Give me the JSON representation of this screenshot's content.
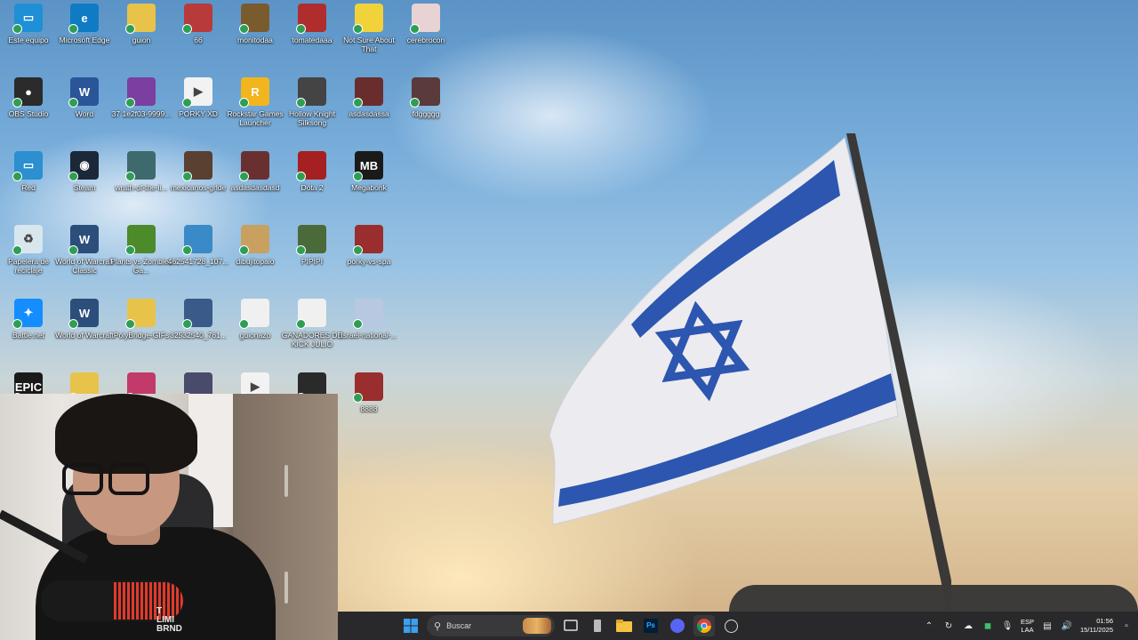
{
  "desktop_icons": [
    {
      "id": "este-equipo",
      "label": "Este equipo",
      "color": "#1f8fd6",
      "glyph": "▭"
    },
    {
      "id": "edge",
      "label": "Microsoft Edge",
      "color": "#0f7bc4",
      "glyph": "e"
    },
    {
      "id": "guion",
      "label": "guion",
      "color": "#e8c34a",
      "glyph": ""
    },
    {
      "id": "66",
      "label": "66",
      "color": "#b83a3a",
      "glyph": ""
    },
    {
      "id": "monitodaa",
      "label": "monitodaa",
      "color": "#7a5b2d",
      "glyph": ""
    },
    {
      "id": "tomatedaaa",
      "label": "tomatedaaa",
      "color": "#b02d2d",
      "glyph": ""
    },
    {
      "id": "notsure",
      "label": "Not Sure About That",
      "color": "#f2d23b",
      "glyph": ""
    },
    {
      "id": "cerebrocon",
      "label": "cerebrocon",
      "color": "#e7d3d3",
      "glyph": ""
    },
    {
      "id": "obs",
      "label": "OBS Studio",
      "color": "#2b2b2b",
      "glyph": "●"
    },
    {
      "id": "word",
      "label": "Word",
      "color": "#2a5699",
      "glyph": "W"
    },
    {
      "id": "37lea",
      "label": "37 1e2f03-9999...",
      "color": "#7a3fa0",
      "glyph": ""
    },
    {
      "id": "porky",
      "label": "PORKY XD",
      "color": "#f2f2f2",
      "glyph": "▶"
    },
    {
      "id": "rockstar",
      "label": "Rockstar Games Launcher",
      "color": "#f3b51d",
      "glyph": "R"
    },
    {
      "id": "hollow",
      "label": "Hollow Knight Silksong",
      "color": "#444",
      "glyph": ""
    },
    {
      "id": "asdasdassa",
      "label": "asdasdassa",
      "color": "#6a2d2d",
      "glyph": ""
    },
    {
      "id": "fdggggg",
      "label": "fdggggg",
      "color": "#5a3a3a",
      "glyph": ""
    },
    {
      "id": "red",
      "label": "Red",
      "color": "#2b8fd0",
      "glyph": "▭"
    },
    {
      "id": "steam",
      "label": "Steam",
      "color": "#1b2838",
      "glyph": "◉"
    },
    {
      "id": "wrath",
      "label": "wrath-of-the-li...",
      "color": "#3e6a6e",
      "glyph": ""
    },
    {
      "id": "mexicanos",
      "label": "mexicanos-grlde",
      "color": "#5a4030",
      "glyph": ""
    },
    {
      "id": "asdasdasdasd",
      "label": "asdasdasdasd",
      "color": "#6a3030",
      "glyph": ""
    },
    {
      "id": "dota2",
      "label": "Dota 2",
      "color": "#a52020",
      "glyph": ""
    },
    {
      "id": "megabonk",
      "label": "Megabonk",
      "color": "#1a1a1a",
      "glyph": "MB"
    },
    {
      "id": "papelera",
      "label": "Papelera de reciclaje",
      "color": "#d8e6ee",
      "glyph": "♻"
    },
    {
      "id": "wowclassic",
      "label": "World of Warcraft Classic",
      "color": "#2c4e7a",
      "glyph": "W"
    },
    {
      "id": "plants",
      "label": "Plants vs Zombies Ga...",
      "color": "#4c8a2a",
      "glyph": ""
    },
    {
      "id": "462",
      "label": "462541728_107...",
      "color": "#3a8ac8",
      "glyph": ""
    },
    {
      "id": "dibujito",
      "label": "dibujitopalo",
      "color": "#c8a060",
      "glyph": ""
    },
    {
      "id": "pipipi",
      "label": "PIPIPI",
      "color": "#4a6a3a",
      "glyph": ""
    },
    {
      "id": "porkyvs",
      "label": "porky-vs-spa",
      "color": "#9a2d2d",
      "glyph": ""
    },
    {
      "id": "battlenet",
      "label": "Battle.net",
      "color": "#148eff",
      "glyph": "✦"
    },
    {
      "id": "wow",
      "label": "World of Warcraft",
      "color": "#2c4e7a",
      "glyph": "W"
    },
    {
      "id": "polybridge",
      "label": "PolyBridge-GIFs",
      "color": "#e8c34a",
      "glyph": ""
    },
    {
      "id": "3253",
      "label": "32532540_761...",
      "color": "#3a5a8a",
      "glyph": ""
    },
    {
      "id": "guionazo",
      "label": "guionazo",
      "color": "#f0f0f0",
      "glyph": ""
    },
    {
      "id": "ganadores",
      "label": "GANADORES DE KICK JULIO",
      "color": "#f0f0f0",
      "glyph": ""
    },
    {
      "id": "israel",
      "label": "Israel-national-...",
      "color": "#b8c8e0",
      "glyph": ""
    },
    {
      "id": "epic",
      "label": "",
      "color": "#1a1a1a",
      "glyph": "EPIC"
    },
    {
      "id": "folder7",
      "label": "",
      "color": "#e8c34a",
      "glyph": ""
    },
    {
      "id": "folder8",
      "label": "",
      "color": "#c23a6a",
      "glyph": ""
    },
    {
      "id": "img9",
      "label": "",
      "color": "#4a4a6a",
      "glyph": ""
    },
    {
      "id": "vid10",
      "label": "",
      "color": "#f2f2f2",
      "glyph": "▶"
    },
    {
      "id": "img11",
      "label": "",
      "color": "#2a2a2a",
      "glyph": ""
    },
    {
      "id": "8888",
      "label": "8888",
      "color": "#9a2d2d",
      "glyph": ""
    }
  ],
  "webcam": {
    "shirt_text": "T\nLIMI\nBRND"
  },
  "taskbar": {
    "search_placeholder": "Buscar",
    "language": "ESP",
    "layout": "LAA",
    "time": "01:56",
    "date": "15/11/2025"
  }
}
